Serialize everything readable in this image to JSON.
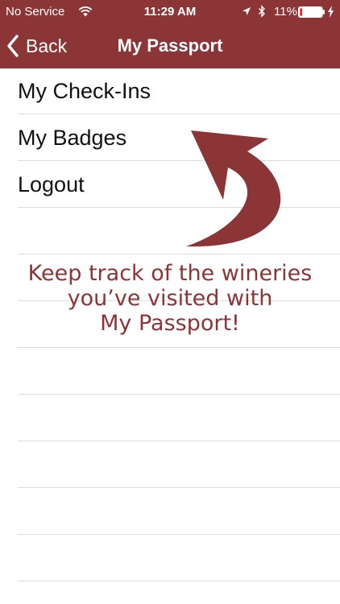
{
  "status_bar": {
    "carrier": "No Service",
    "time": "11:29 AM",
    "battery": "11%",
    "icons": [
      "wifi-icon",
      "location-arrow-icon",
      "bluetooth-icon",
      "battery-icon",
      "charging-bolt-icon"
    ],
    "battery_level": 0.11
  },
  "nav": {
    "back_label": "Back",
    "title": "My Passport"
  },
  "menu": {
    "items": [
      {
        "label": "My Check-Ins"
      },
      {
        "label": "My Badges"
      },
      {
        "label": "Logout"
      }
    ]
  },
  "promo": {
    "lines": [
      "Keep track of the wineries",
      "you’ve visited with",
      "My Passport!"
    ]
  },
  "colors": {
    "brand": "#8b3537",
    "divider": "#dcdcdc",
    "battery_low": "#e8232a"
  }
}
